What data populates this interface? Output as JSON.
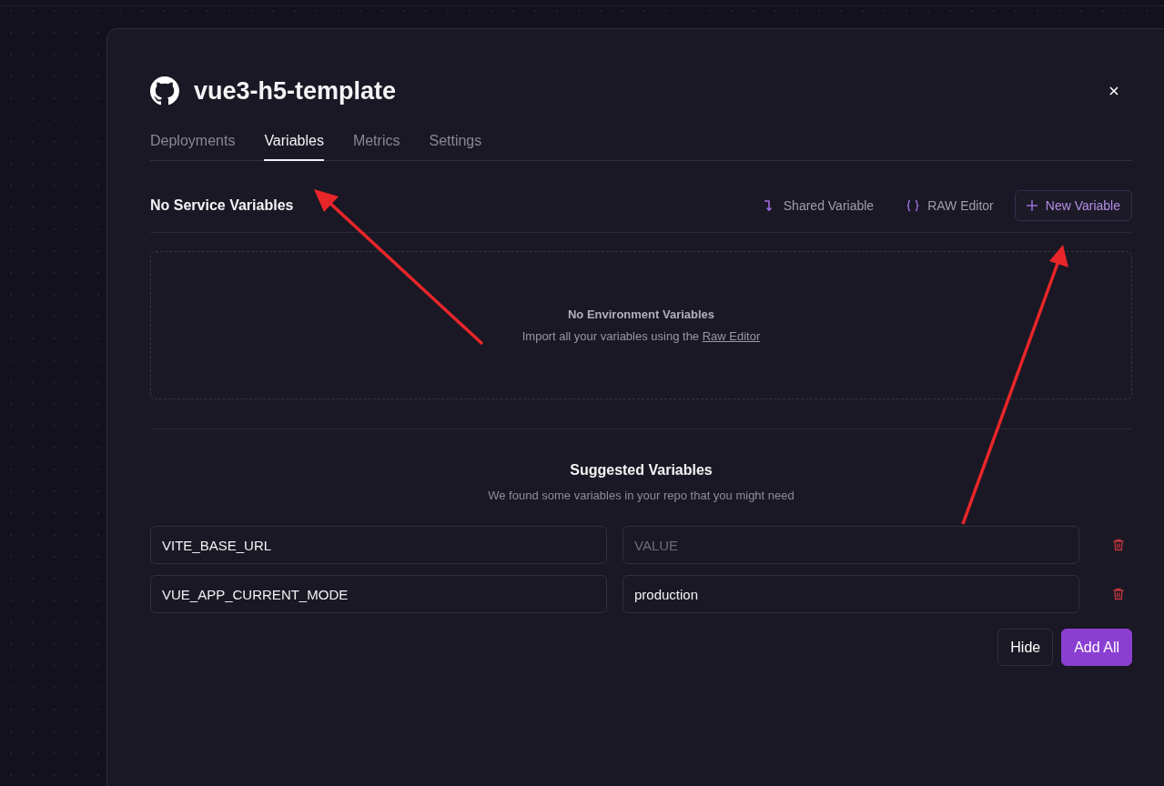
{
  "project": {
    "title": "vue3-h5-template"
  },
  "tabs": [
    {
      "label": "Deployments",
      "selected": false
    },
    {
      "label": "Variables",
      "selected": true
    },
    {
      "label": "Metrics",
      "selected": false
    },
    {
      "label": "Settings",
      "selected": false
    }
  ],
  "section": {
    "title": "No Service Variables",
    "actions": [
      {
        "kind": "shared",
        "label": "Shared Variable"
      },
      {
        "kind": "raw",
        "label": "RAW Editor"
      },
      {
        "kind": "new",
        "label": "New Variable"
      }
    ]
  },
  "empty_state": {
    "title": "No Environment Variables",
    "text": "Import all your variables using the ",
    "link": "Raw Editor"
  },
  "suggested": {
    "title": "Suggested Variables",
    "subtitle": "We found some variables in your repo that you might need",
    "rows": [
      {
        "name": "VITE_BASE_URL",
        "placeholder": "VALUE"
      },
      {
        "name": "VUE_APP_CURRENT_MODE",
        "value": "production"
      }
    ],
    "buttons": [
      {
        "kind": "secondary",
        "label": "Hide"
      },
      {
        "kind": "primary",
        "label": "Add All"
      }
    ]
  }
}
